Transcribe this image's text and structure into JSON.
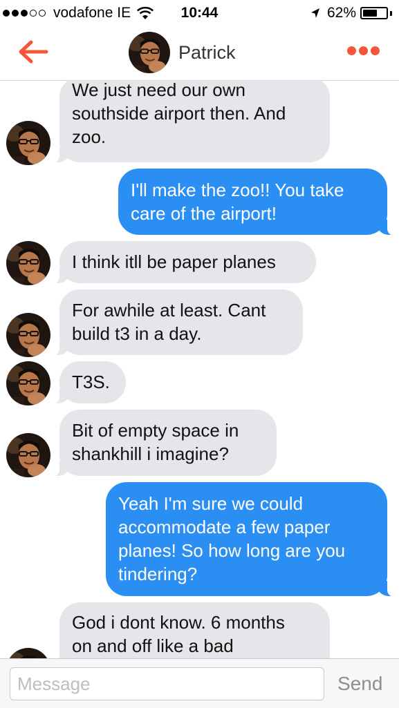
{
  "status_bar": {
    "carrier": "vodafone IE",
    "time": "10:44",
    "battery_percent": "62%",
    "battery_level": 0.62,
    "signal_bars": 3,
    "signal_total": 5
  },
  "header": {
    "contact_name": "Patrick",
    "accent_color": "#f5553b",
    "back_icon": "arrow-left",
    "more_icon": "three-dots"
  },
  "messages": [
    {
      "sender": "them",
      "text": "We just need our own\nsouthside airport then. And\nzoo."
    },
    {
      "sender": "me",
      "text": "I'll make the zoo!! You take\ncare of the airport!"
    },
    {
      "sender": "them",
      "text": "I think itll be paper planes"
    },
    {
      "sender": "them",
      "text": "For awhile at least. Cant\nbuild t3 in a day."
    },
    {
      "sender": "them",
      "text": "T3S."
    },
    {
      "sender": "them",
      "text": "Bit of empty space in\nshankhill i imagine?"
    },
    {
      "sender": "me",
      "text": "Yeah I'm sure we could\naccommodate a few paper\nplanes! So how long are you\ntindering?"
    },
    {
      "sender": "them",
      "text": "God i dont know. 6 months\non and off like a bad"
    }
  ],
  "composer": {
    "placeholder": "Message",
    "value": "",
    "send_label": "Send"
  },
  "colors": {
    "incoming_bubble": "#e5e5ea",
    "outgoing_bubble": "#2b8ef3"
  }
}
